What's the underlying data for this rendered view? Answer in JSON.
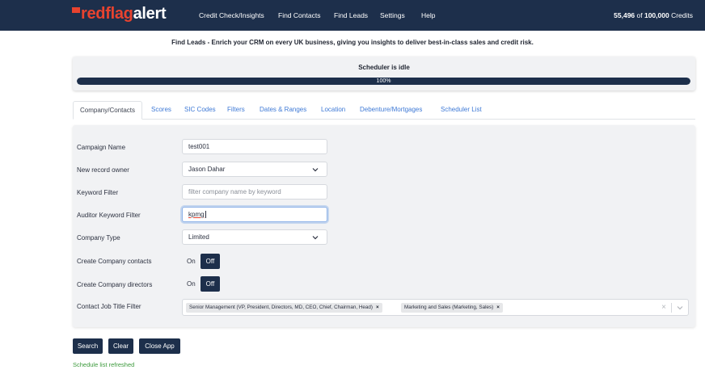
{
  "brand": {
    "logo_part1": "redflag",
    "logo_part2": "alert",
    "accent": "#e8432f",
    "navy": "#1d2f4b"
  },
  "nav": {
    "items": [
      {
        "label": "Credit Check/Insights"
      },
      {
        "label": "Find Contacts"
      },
      {
        "label": "Find Leads"
      },
      {
        "label": "Settings"
      },
      {
        "label": "Help"
      }
    ],
    "credits_used": "55,496",
    "credits_of": " of ",
    "credits_total": "100,000",
    "credits_suffix": " Credits"
  },
  "headline": "Find Leads - Enrich your CRM on every UK business, giving you insights to deliver best-in-class sales and credit risk.",
  "scheduler": {
    "title": "Scheduler is idle",
    "progress_label": "100%",
    "progress_percent": 100
  },
  "tabs": [
    {
      "label": "Company/Contacts",
      "active": true
    },
    {
      "label": "Scores"
    },
    {
      "label": "SIC Codes"
    },
    {
      "label": "Filters"
    },
    {
      "label": "Dates & Ranges"
    },
    {
      "label": "Location"
    },
    {
      "label": "Debenture/Mortgages"
    },
    {
      "label": "Scheduler List"
    }
  ],
  "form": {
    "campaign_name": {
      "label": "Campaign Name",
      "value": "test001"
    },
    "record_owner": {
      "label": "New record owner",
      "value": "Jason Dahar"
    },
    "keyword_filter": {
      "label": "Keyword Filter",
      "placeholder": "filter company name by keyword"
    },
    "auditor_filter": {
      "label": "Auditor Keyword Filter",
      "value": "kpmg"
    },
    "company_type": {
      "label": "Company Type",
      "value": "Limited"
    },
    "create_contacts": {
      "label": "Create Company contacts",
      "on_label": "On",
      "off_label": "Off"
    },
    "create_directors": {
      "label": "Create Company directors",
      "on_label": "On",
      "off_label": "Off"
    },
    "job_title_filter": {
      "label": "Contact Job Title Filter",
      "chips": [
        "Senior Management (VP, President, Directors, MD, CEO, Chief, Chairman, Head)",
        "Marketing and Sales (Marketing, Sales)"
      ],
      "chip_remove": "×",
      "clear": "×"
    }
  },
  "buttons": {
    "search": "Search",
    "clear": "Clear",
    "close": "Close App"
  },
  "status": "Schedule list refreshed"
}
